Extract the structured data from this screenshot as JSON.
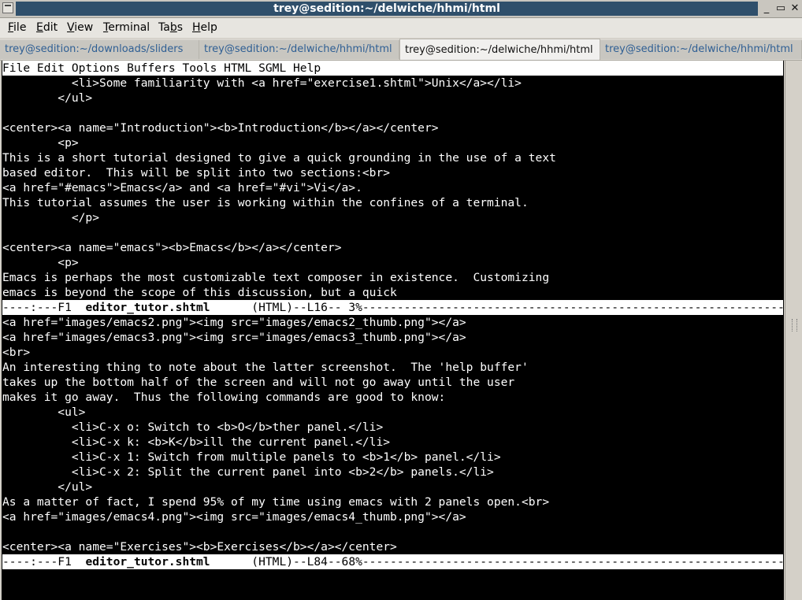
{
  "window": {
    "title": "trey@sedition:~/delwiche/hhmi/html",
    "controls": [
      "_",
      "▭",
      "✕"
    ]
  },
  "menubar": [
    {
      "label": "File",
      "accel": "F"
    },
    {
      "label": "Edit",
      "accel": "E"
    },
    {
      "label": "View",
      "accel": "V"
    },
    {
      "label": "Terminal",
      "accel": "T"
    },
    {
      "label": "Tabs",
      "accel": "b"
    },
    {
      "label": "Help",
      "accel": "H"
    }
  ],
  "tabs": [
    {
      "label": "trey@sedition:~/downloads/sliders",
      "active": false
    },
    {
      "label": "trey@sedition:~/delwiche/hhmi/html",
      "active": false
    },
    {
      "label": "trey@sedition:~/delwiche/hhmi/html",
      "active": true
    },
    {
      "label": "trey@sedition:~/delwiche/hhmi/html",
      "active": false
    }
  ],
  "emacs": {
    "menu": "File Edit Options Buffers Tools HTML SGML Help",
    "top_pane": [
      "          <li>Some familiarity with <a href=\"exercise1.shtml\">Unix</a></li>",
      "        </ul>",
      "",
      "<center><a name=\"Introduction\"><b>Introduction</b></a></center>",
      "        <p>",
      "This is a short tutorial designed to give a quick grounding in the use of a text",
      "based editor.  This will be split into two sections:<br>",
      "<a href=\"#emacs\">Emacs</a> and <a href=\"#vi\">Vi</a>.",
      "This tutorial assumes the user is working within the confines of a terminal.",
      "          </p>",
      "",
      "<center><a name=\"emacs\"><b>Emacs</b></a></center>",
      "        <p>",
      "Emacs is perhaps the most customizable text composer in existence.  Customizing",
      "emacs is beyond the scope of this discussion, but a quick"
    ],
    "mode_line_1": {
      "prefix": "----:---F1  ",
      "buffer": "editor_tutor.shtml",
      "suffix": "      (HTML)--L16-- 3%-------------------------------------------------------------------------"
    },
    "bottom_pane": [
      "<a href=\"images/emacs2.png\"><img src=\"images/emacs2_thumb.png\"></a>",
      "<a href=\"images/emacs3.png\"><img src=\"images/emacs3_thumb.png\"></a>",
      "<br>",
      "An interesting thing to note about the latter screenshot.  The 'help buffer'",
      "takes up the bottom half of the screen and will not go away until the user",
      "makes it go away.  Thus the following commands are good to know:",
      "        <ul>",
      "          <li>C-x o: Switch to <b>O</b>ther panel.</li>",
      "          <li>C-x k: <b>K</b>ill the current panel.</li>",
      "          <li>C-x 1: Switch from multiple panels to <b>1</b> panel.</li>",
      "          <li>C-x 2: Split the current panel into <b>2</b> panels.</li>",
      "        </ul>",
      "As a matter of fact, I spend 95% of my time using emacs with 2 panels open.<br>",
      "<a href=\"images/emacs4.png\"><img src=\"images/emacs4_thumb.png\"></a>",
      "",
      "<center><a name=\"Exercises\"><b>Exercises</b></a></center>"
    ],
    "mode_line_2": {
      "prefix": "----:---F1  ",
      "buffer": "editor_tutor.shtml",
      "suffix": "      (HTML)--L84--68%-------------------------------------------------------------------------"
    },
    "minibuffer": ""
  }
}
